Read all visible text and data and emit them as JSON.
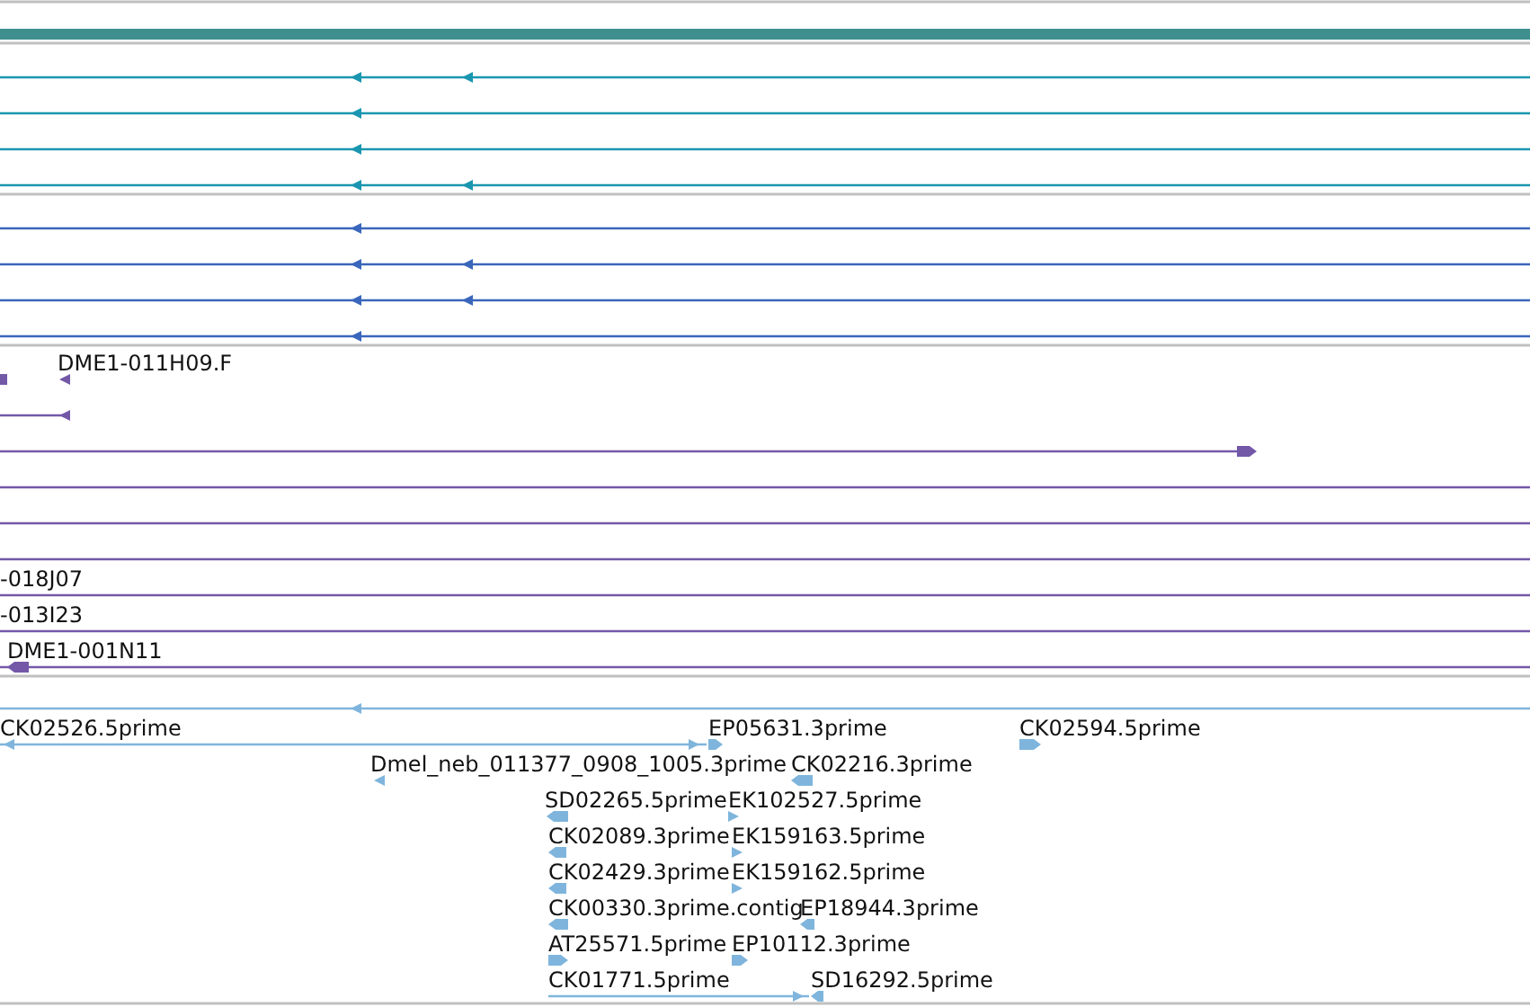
{
  "tracks": [
    {
      "color": "#1a96b0",
      "rows": [
        {
          "features": [
            {
              "kind": "span"
            },
            {
              "kind": "tick",
              "reverse": true
            },
            {
              "kind": "tick",
              "reverse": true
            }
          ]
        },
        {
          "features": [
            {
              "kind": "span"
            },
            {
              "kind": "tick",
              "reverse": true
            }
          ]
        },
        {
          "features": [
            {
              "kind": "span"
            },
            {
              "kind": "tick",
              "reverse": true
            }
          ]
        },
        {
          "features": [
            {
              "kind": "span"
            },
            {
              "kind": "tick",
              "reverse": true
            },
            {
              "kind": "tick",
              "reverse": true
            }
          ]
        }
      ]
    },
    {
      "color": "#3a66bb",
      "rows": [
        {
          "features": [
            {
              "kind": "span"
            },
            {
              "kind": "tick",
              "reverse": true
            }
          ]
        },
        {
          "features": [
            {
              "kind": "span"
            },
            {
              "kind": "tick",
              "reverse": true
            },
            {
              "kind": "tick",
              "reverse": true
            }
          ]
        },
        {
          "features": [
            {
              "kind": "span"
            },
            {
              "kind": "tick",
              "reverse": true
            },
            {
              "kind": "tick",
              "reverse": true
            }
          ]
        },
        {
          "features": [
            {
              "kind": "span"
            },
            {
              "kind": "tick",
              "reverse": true
            }
          ]
        }
      ]
    },
    {
      "color": "#7358a8",
      "rows": [
        {
          "features": [
            {
              "kind": "box"
            },
            {
              "kind": "tick",
              "reverse": true,
              "label": "DME1-011H09.F"
            }
          ]
        },
        {
          "features": [
            {
              "kind": "span"
            },
            {
              "kind": "tick",
              "reverse": true
            }
          ]
        },
        {
          "features": [
            {
              "kind": "span"
            },
            {
              "kind": "block",
              "reverse": false
            }
          ]
        },
        {
          "features": [
            {
              "kind": "span"
            }
          ]
        },
        {
          "features": [
            {
              "kind": "span"
            }
          ]
        },
        {
          "features": [
            {
              "kind": "span"
            }
          ]
        },
        {
          "features": [
            {
              "kind": "span",
              "label": "-018J07"
            }
          ]
        },
        {
          "features": [
            {
              "kind": "span",
              "label": "-013I23"
            }
          ]
        },
        {
          "features": [
            {
              "kind": "span"
            },
            {
              "kind": "block",
              "reverse": true,
              "label": "DME1-001N11"
            }
          ]
        }
      ]
    },
    {
      "color": "#7fb5dc",
      "rows": [
        {
          "features": [
            {
              "kind": "span"
            },
            {
              "kind": "tick",
              "reverse": true
            }
          ]
        },
        {
          "features": [
            {
              "kind": "span",
              "label": "CK02526.5prime"
            },
            {
              "kind": "tick",
              "reverse": true
            },
            {
              "kind": "tick",
              "reverse": false
            },
            {
              "kind": "block",
              "reverse": false,
              "label": "EP05631.3prime"
            },
            {
              "kind": "block",
              "reverse": false,
              "label": "CK02594.5prime"
            }
          ]
        },
        {
          "features": [
            {
              "kind": "tick",
              "reverse": true,
              "label": "Dmel_neb_011377_0908_1005.3prime"
            },
            {
              "kind": "block",
              "reverse": true,
              "label": "CK02216.3prime"
            }
          ]
        },
        {
          "features": [
            {
              "kind": "block",
              "reverse": true,
              "label": "SD02265.5prime"
            },
            {
              "kind": "tick",
              "reverse": false,
              "label": "EK102527.5prime"
            }
          ]
        },
        {
          "features": [
            {
              "kind": "block",
              "reverse": true,
              "label": "CK02089.3prime"
            },
            {
              "kind": "tick",
              "reverse": false,
              "label": "EK159163.5prime"
            }
          ]
        },
        {
          "features": [
            {
              "kind": "block",
              "reverse": true,
              "label": "CK02429.3prime"
            },
            {
              "kind": "tick",
              "reverse": false,
              "label": "EK159162.5prime"
            }
          ]
        },
        {
          "features": [
            {
              "kind": "block",
              "reverse": true,
              "label": "CK00330.3prime.contig"
            },
            {
              "kind": "block",
              "reverse": true,
              "label": "EP18944.3prime"
            }
          ]
        },
        {
          "features": [
            {
              "kind": "block",
              "reverse": false,
              "label": "AT25571.5prime"
            },
            {
              "kind": "block",
              "reverse": false,
              "label": "EP10112.3prime"
            }
          ]
        },
        {
          "features": [
            {
              "kind": "span",
              "label": "CK01771.5prime"
            },
            {
              "kind": "tick",
              "reverse": false
            },
            {
              "kind": "block",
              "reverse": true,
              "label": "SD16292.5prime"
            }
          ]
        }
      ]
    }
  ]
}
